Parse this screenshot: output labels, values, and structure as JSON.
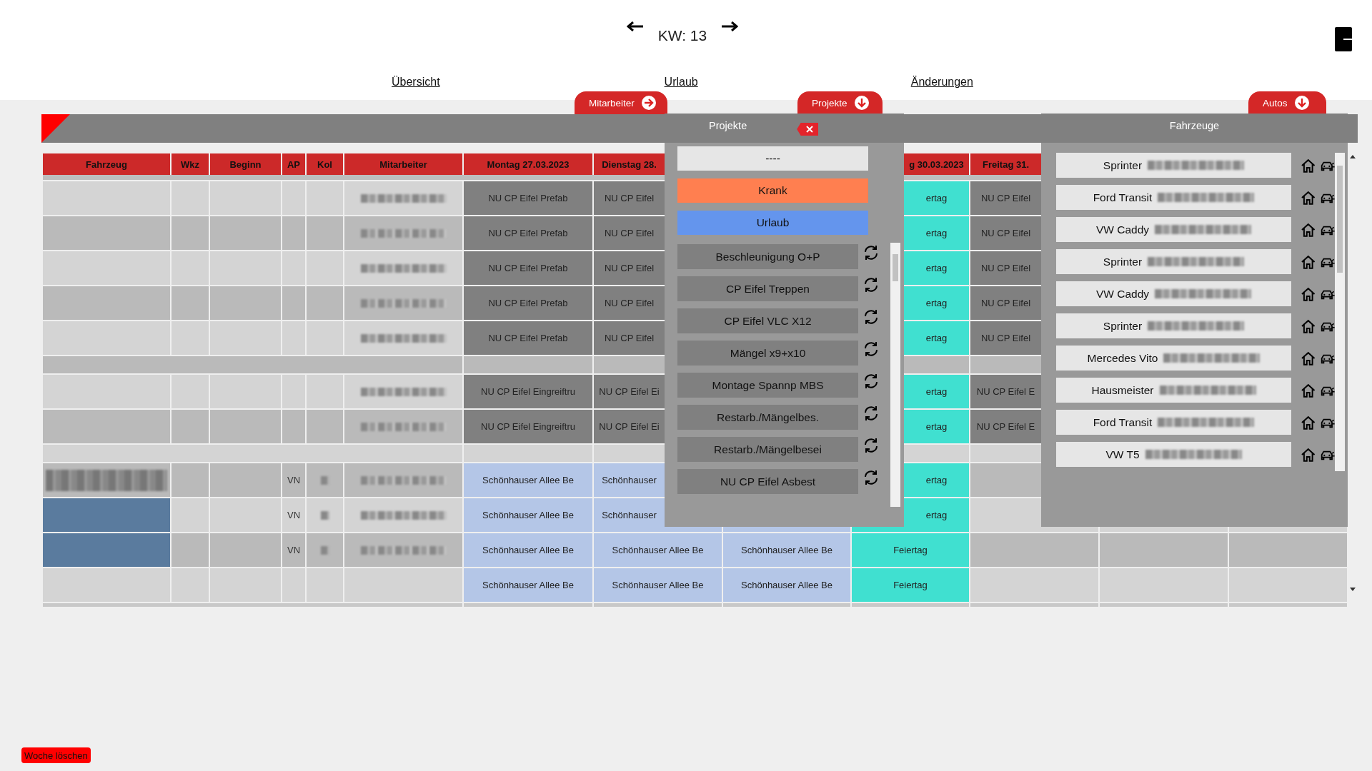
{
  "week": {
    "label": "KW: 13"
  },
  "nav": [
    "Übersicht",
    "Urlaub",
    "Änderungen"
  ],
  "panel_tabs": [
    {
      "label": "Mitarbeiter",
      "kind": "collapse"
    },
    {
      "label": "Projekte",
      "kind": "expand"
    },
    {
      "label": "Autos",
      "kind": "expand"
    }
  ],
  "table": {
    "columns": [
      "Fahrzeug",
      "Wkz",
      "Beginn",
      "AP",
      "Kol",
      "Mitarbeiter",
      "Montag 27.03.2023",
      "Dienstag 28.",
      "g 30.03.2023",
      "Freitag 31."
    ],
    "rows": [
      {
        "kind": "entry",
        "employee_hidden": true,
        "days": [
          {
            "kind": "project",
            "text": "NU CP Eifel Prefab"
          },
          {
            "kind": "project",
            "text": "NU CP Eifel"
          },
          {
            "kind": "project"
          },
          {
            "kind": "holiday",
            "text": "ertag"
          },
          {
            "kind": "project",
            "text": "NU CP Eifel"
          },
          {
            "kind": "empty"
          },
          {
            "kind": "empty"
          }
        ]
      },
      {
        "kind": "entry",
        "employee_hidden": true,
        "days": [
          {
            "kind": "project",
            "text": "NU CP Eifel Prefab"
          },
          {
            "kind": "project",
            "text": "NU CP Eifel"
          },
          {
            "kind": "project"
          },
          {
            "kind": "holiday",
            "text": "ertag"
          },
          {
            "kind": "project",
            "text": "NU CP Eifel"
          },
          {
            "kind": "empty"
          },
          {
            "kind": "empty"
          }
        ]
      },
      {
        "kind": "entry",
        "employee_hidden": true,
        "days": [
          {
            "kind": "project",
            "text": "NU CP Eifel Prefab"
          },
          {
            "kind": "project",
            "text": "NU CP Eifel"
          },
          {
            "kind": "project"
          },
          {
            "kind": "holiday",
            "text": "ertag"
          },
          {
            "kind": "project",
            "text": "NU CP Eifel"
          },
          {
            "kind": "empty"
          },
          {
            "kind": "empty"
          }
        ]
      },
      {
        "kind": "entry",
        "employee_hidden": true,
        "days": [
          {
            "kind": "project",
            "text": "NU CP Eifel Prefab"
          },
          {
            "kind": "project",
            "text": "NU CP Eifel"
          },
          {
            "kind": "project"
          },
          {
            "kind": "holiday",
            "text": "ertag"
          },
          {
            "kind": "project",
            "text": "NU CP Eifel"
          },
          {
            "kind": "empty"
          },
          {
            "kind": "empty"
          }
        ]
      },
      {
        "kind": "entry",
        "employee_hidden": true,
        "days": [
          {
            "kind": "project",
            "text": "NU CP Eifel Prefab"
          },
          {
            "kind": "project",
            "text": "NU CP Eifel"
          },
          {
            "kind": "project"
          },
          {
            "kind": "holiday",
            "text": "ertag"
          },
          {
            "kind": "project",
            "text": "NU CP Eifel"
          },
          {
            "kind": "empty"
          },
          {
            "kind": "empty"
          }
        ]
      },
      {
        "kind": "separator"
      },
      {
        "kind": "entry",
        "employee_hidden": true,
        "days": [
          {
            "kind": "project",
            "text": "NU CP Eifel Eingreiftru"
          },
          {
            "kind": "project",
            "text": "NU CP Eifel Ei"
          },
          {
            "kind": "project"
          },
          {
            "kind": "holiday",
            "text": "ertag"
          },
          {
            "kind": "project",
            "text": "NU CP Eifel E"
          },
          {
            "kind": "empty"
          },
          {
            "kind": "empty"
          }
        ]
      },
      {
        "kind": "entry",
        "employee_hidden": true,
        "days": [
          {
            "kind": "project",
            "text": "NU CP Eifel Eingreiftru"
          },
          {
            "kind": "project",
            "text": "NU CP Eifel Ei"
          },
          {
            "kind": "project"
          },
          {
            "kind": "holiday",
            "text": "ertag"
          },
          {
            "kind": "project",
            "text": "NU CP Eifel E"
          },
          {
            "kind": "empty"
          },
          {
            "kind": "empty"
          }
        ]
      },
      {
        "kind": "separator"
      },
      {
        "kind": "entry",
        "vehicle_hidden": true,
        "ap": "VN",
        "kol_hidden": true,
        "employee_hidden": true,
        "days": [
          {
            "kind": "site",
            "text": "Schönhauser Allee Be"
          },
          {
            "kind": "site",
            "text": "Schönhauser"
          },
          {
            "kind": "site"
          },
          {
            "kind": "holiday",
            "text": "ertag"
          },
          {
            "kind": "empty"
          },
          {
            "kind": "empty"
          },
          {
            "kind": "empty"
          }
        ]
      },
      {
        "kind": "entry",
        "color": "#5a7b9e",
        "ap": "VN",
        "kol_hidden": true,
        "employee_hidden": true,
        "days": [
          {
            "kind": "site",
            "text": "Schönhauser Allee Be"
          },
          {
            "kind": "site",
            "text": "Schönhauser"
          },
          {
            "kind": "site"
          },
          {
            "kind": "holiday",
            "text": "ertag"
          },
          {
            "kind": "empty"
          },
          {
            "kind": "empty"
          },
          {
            "kind": "empty"
          }
        ]
      },
      {
        "kind": "entry",
        "color": "#5a7b9e",
        "ap": "VN",
        "kol_hidden": true,
        "employee_hidden": true,
        "days": [
          {
            "kind": "site",
            "text": "Schönhauser Allee Be"
          },
          {
            "kind": "site",
            "text": "Schönhauser Allee Be"
          },
          {
            "kind": "site",
            "text": "Schönhauser Allee Be"
          },
          {
            "kind": "holiday",
            "text": "Feiertag"
          },
          {
            "kind": "empty"
          },
          {
            "kind": "empty"
          },
          {
            "kind": "empty"
          }
        ]
      },
      {
        "kind": "entry",
        "days": [
          {
            "kind": "site",
            "text": "Schönhauser Allee Be"
          },
          {
            "kind": "site",
            "text": "Schönhauser Allee Be"
          },
          {
            "kind": "site",
            "text": "Schönhauser Allee Be"
          },
          {
            "kind": "holiday",
            "text": "Feiertag"
          },
          {
            "kind": "empty"
          },
          {
            "kind": "empty"
          },
          {
            "kind": "empty"
          }
        ]
      }
    ]
  },
  "projects_popup": {
    "title": "Projekte",
    "fixed": [
      {
        "label": "----",
        "kind": "none"
      },
      {
        "label": "Krank",
        "kind": "sick"
      },
      {
        "label": "Urlaub",
        "kind": "vacation"
      }
    ],
    "items": [
      "Beschleunigung O+P",
      "CP Eifel Treppen",
      "CP Eifel VLC X12",
      "Mängel x9+x10",
      "Montage Spannp MBS",
      "Restarb./Mängelbes.",
      "Restarb./Mängelbesei",
      "NU CP Eifel Asbest"
    ]
  },
  "vehicles_panel": {
    "title": "Fahrzeuge",
    "items": [
      {
        "name": "Sprinter",
        "plate_hidden": true
      },
      {
        "name": "Ford Transit",
        "plate_hidden": true
      },
      {
        "name": "VW Caddy",
        "plate_hidden": true
      },
      {
        "name": "Sprinter",
        "plate_hidden": true
      },
      {
        "name": "VW Caddy",
        "plate_hidden": true
      },
      {
        "name": "Sprinter",
        "plate_hidden": true
      },
      {
        "name": "Mercedes Vito",
        "plate_hidden": true
      },
      {
        "name": "Hausmeister",
        "plate_hidden": true
      },
      {
        "name": "Ford Transit",
        "plate_hidden": true
      },
      {
        "name": "VW T5",
        "plate_hidden": true
      }
    ]
  },
  "delete_week_button": "Woche löschen"
}
